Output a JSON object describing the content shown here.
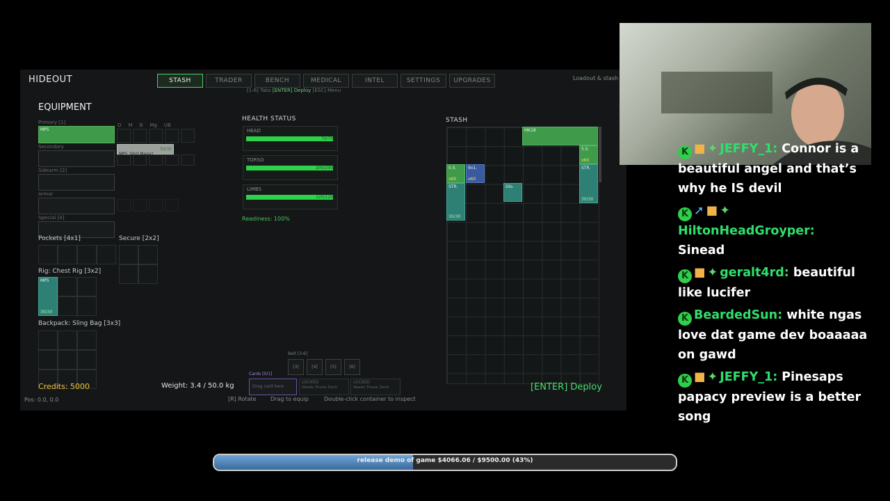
{
  "game": {
    "title": "HIDEOUT",
    "loadout_hint": "Loadout & stash",
    "tabs": [
      {
        "label": "STASH",
        "active": true
      },
      {
        "label": "TRADER",
        "active": false
      },
      {
        "label": "BENCH",
        "active": false
      },
      {
        "label": "MEDICAL",
        "active": false
      },
      {
        "label": "INTEL",
        "active": false
      },
      {
        "label": "SETTINGS",
        "active": false
      },
      {
        "label": "UPGRADES",
        "active": false
      }
    ],
    "hint": {
      "a": "[1-6] Tabs",
      "b": "[ENTER] Deploy",
      "c": "[ESC] Menu"
    },
    "equipment": {
      "title": "EQUIPMENT",
      "primary_label": "Primary [1]",
      "primary_item": "MP5",
      "secondary_label": "Secondary",
      "sidearm_label": "Sidearm [2]",
      "armor_label": "Armor",
      "special_label": "Special [4]",
      "mod_labels": [
        "O",
        "M",
        "B",
        "Mg",
        "UB"
      ],
      "magazine_item": "MP5 30rd Magaz",
      "magazine_count": "30/30",
      "pockets_label": "Pockets [4x1]",
      "secure_label": "Secure [2x2]",
      "rig_label": "Rig: Chest Rig [3x2]",
      "rig_item": "MP5",
      "rig_count": "30/30",
      "backpack_label": "Backpack: Sling Bag [3x3]"
    },
    "health": {
      "title": "HEALTH STATUS",
      "parts": [
        {
          "label": "HEAD",
          "value": "70/70",
          "fraction": 1
        },
        {
          "label": "TORSO",
          "value": "200/200",
          "fraction": 1
        },
        {
          "label": "LIMBS",
          "value": "120/120",
          "fraction": 1
        }
      ],
      "readiness": "Readiness: 100%"
    },
    "stash": {
      "title": "STASH",
      "items": {
        "mk": "MK18",
        "ss1": "5.5.",
        "ss1c": "x60",
        "ss2": "5.5.",
        "ss2c": "x60",
        "sx": "9x1.",
        "sxc": "x60",
        "str1": "STR.",
        "str1c": "30/30",
        "str2": "STR.",
        "str2c": "30/30",
        "glo": "Glo."
      }
    },
    "belt_label": "Belt [3-6]",
    "belt_slots": [
      "[3]",
      "[4]",
      "[5]",
      "[6]"
    ],
    "cards_label": "Cards [0/1]",
    "card_drop": "Drag card here",
    "locked": [
      {
        "t": "LOCKED",
        "s": "Needs Triune Deck"
      },
      {
        "t": "LOCKED",
        "s": "Needs Triune Deck"
      }
    ],
    "credits": "Credits: 5000",
    "weight": "Weight: 3.4 / 50.0 kg",
    "deploy": "[ENTER] Deploy",
    "pos": "Pos: 0.0, 0.0",
    "footer": {
      "rotate": "[R] Rotate",
      "drag": "Drag to equip",
      "dbl": "Double-click container to inspect"
    }
  },
  "chat": [
    {
      "user": "JEFFY_1:",
      "text": "Connor is a beautiful angel and that’s why he IS devil",
      "icons": [
        "badge",
        "gift",
        "star"
      ]
    },
    {
      "user": "HiltonHeadGroyper:",
      "text": "Sinead",
      "icons": [
        "badge",
        "sword",
        "gift",
        "star"
      ]
    },
    {
      "user": "geralt4rd:",
      "text": "beautiful like lucifer",
      "icons": [
        "badge",
        "gift",
        "star"
      ]
    },
    {
      "user": "BeardedSun:",
      "text": "white ngas love dat game dev boaaaaa on gawd",
      "icons": [
        "badge"
      ]
    },
    {
      "user": "JEFFY_1:",
      "text": "Pinesaps papacy preview is a better song",
      "icons": [
        "badge",
        "gift",
        "star"
      ]
    }
  ],
  "goal": {
    "label": "release demo of game $4066.06 / $9500.00 (43%)",
    "fraction": 0.43
  }
}
